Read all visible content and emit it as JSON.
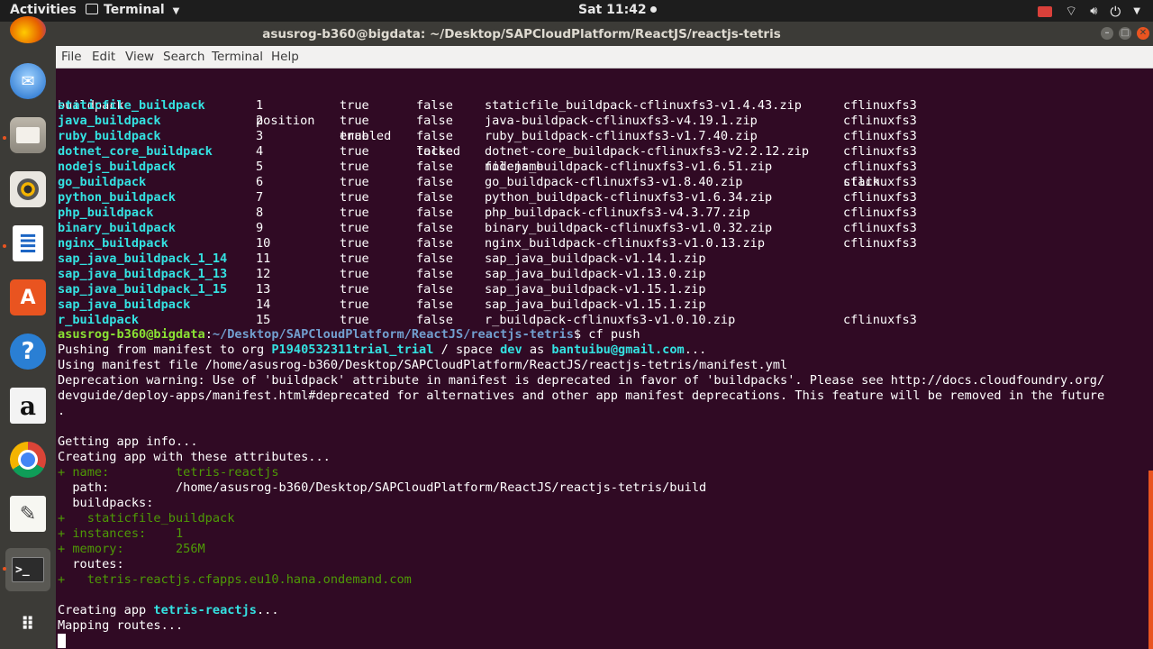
{
  "topbar": {
    "activities": "Activities",
    "app_name": "Terminal",
    "clock": "Sat 11:42"
  },
  "window": {
    "title": "asusrog-b360@bigdata: ~/Desktop/SAPCloudPlatform/ReactJS/reactjs-tetris",
    "menus": [
      "File",
      "Edit",
      "View",
      "Search",
      "Terminal",
      "Help"
    ]
  },
  "dock": {
    "items": [
      "firefox-icon",
      "thunderbird-icon",
      "files-icon",
      "rhythmbox-icon",
      "libreoffice-writer-icon",
      "software-center-icon",
      "help-icon",
      "amazon-icon",
      "chrome-icon",
      "text-editor-icon",
      "terminal-icon",
      "show-apps-icon"
    ]
  },
  "colors": {
    "terminal_bg": "#300a24",
    "buildpack_name": "#34e2e2",
    "prompt_user": "#8ae234",
    "prompt_path": "#729fcf",
    "diff_added": "#4e9a06",
    "accent": "#e95420"
  },
  "terminal": {
    "buildpack_header": [
      "buildpack",
      "position",
      "enabled",
      "locked",
      "filename",
      "stack"
    ],
    "buildpacks": [
      [
        "staticfile_buildpack",
        "1",
        "true",
        "false",
        "staticfile_buildpack-cflinuxfs3-v1.4.43.zip",
        "cflinuxfs3"
      ],
      [
        "java_buildpack",
        "2",
        "true",
        "false",
        "java-buildpack-cflinuxfs3-v4.19.1.zip",
        "cflinuxfs3"
      ],
      [
        "ruby_buildpack",
        "3",
        "true",
        "false",
        "ruby_buildpack-cflinuxfs3-v1.7.40.zip",
        "cflinuxfs3"
      ],
      [
        "dotnet_core_buildpack",
        "4",
        "true",
        "false",
        "dotnet-core_buildpack-cflinuxfs3-v2.2.12.zip",
        "cflinuxfs3"
      ],
      [
        "nodejs_buildpack",
        "5",
        "true",
        "false",
        "nodejs_buildpack-cflinuxfs3-v1.6.51.zip",
        "cflinuxfs3"
      ],
      [
        "go_buildpack",
        "6",
        "true",
        "false",
        "go_buildpack-cflinuxfs3-v1.8.40.zip",
        "cflinuxfs3"
      ],
      [
        "python_buildpack",
        "7",
        "true",
        "false",
        "python_buildpack-cflinuxfs3-v1.6.34.zip",
        "cflinuxfs3"
      ],
      [
        "php_buildpack",
        "8",
        "true",
        "false",
        "php_buildpack-cflinuxfs3-v4.3.77.zip",
        "cflinuxfs3"
      ],
      [
        "binary_buildpack",
        "9",
        "true",
        "false",
        "binary_buildpack-cflinuxfs3-v1.0.32.zip",
        "cflinuxfs3"
      ],
      [
        "nginx_buildpack",
        "10",
        "true",
        "false",
        "nginx_buildpack-cflinuxfs3-v1.0.13.zip",
        "cflinuxfs3"
      ],
      [
        "sap_java_buildpack_1_14",
        "11",
        "true",
        "false",
        "sap_java_buildpack-v1.14.1.zip",
        ""
      ],
      [
        "sap_java_buildpack_1_13",
        "12",
        "true",
        "false",
        "sap_java_buildpack-v1.13.0.zip",
        ""
      ],
      [
        "sap_java_buildpack_1_15",
        "13",
        "true",
        "false",
        "sap_java_buildpack-v1.15.1.zip",
        ""
      ],
      [
        "sap_java_buildpack",
        "14",
        "true",
        "false",
        "sap_java_buildpack-v1.15.1.zip",
        ""
      ],
      [
        "r_buildpack",
        "15",
        "true",
        "false",
        "r_buildpack-cflinuxfs3-v1.0.10.zip",
        "cflinuxfs3"
      ]
    ],
    "prompt_user": "asusrog-b360@bigdata",
    "prompt_path": "~/Desktop/SAPCloudPlatform/ReactJS/reactjs-tetris",
    "command": "$ cf push",
    "push": {
      "prefix": "Pushing from manifest to org ",
      "org": "P1940532311trial_trial",
      "mid": " / space ",
      "space": "dev",
      "as": " as ",
      "user": "bantuibu@gmail.com",
      "suffix": "..."
    },
    "manifest_line": "Using manifest file /home/asusrog-b360/Desktop/SAPCloudPlatform/ReactJS/reactjs-tetris/manifest.yml",
    "deprecation": [
      "Deprecation warning: Use of 'buildpack' attribute in manifest is deprecated in favor of 'buildpacks'. Please see http://docs.cloudfoundry.org/",
      "devguide/deploy-apps/manifest.html#deprecated for alternatives and other app manifest deprecations. This feature will be removed in the future",
      "."
    ],
    "getting_info": "Getting app info...",
    "creating_attrs": "Creating app with these attributes...",
    "attrs": {
      "name_line": "+ name:         tetris-reactjs",
      "path_line": "  path:         /home/asusrog-b360/Desktop/SAPCloudPlatform/ReactJS/reactjs-tetris/build",
      "buildpacks_line": "  buildpacks:",
      "staticfile_line": "+   staticfile_buildpack",
      "instances_line": "+ instances:    1",
      "memory_line": "+ memory:       256M",
      "routes_line": "  routes:",
      "route_line": "+   tetris-reactjs.cfapps.eu10.hana.ondemand.com"
    },
    "creating_prefix": "Creating app ",
    "creating_app": "tetris-reactjs",
    "creating_suffix": "...",
    "mapping": "Mapping routes..."
  }
}
